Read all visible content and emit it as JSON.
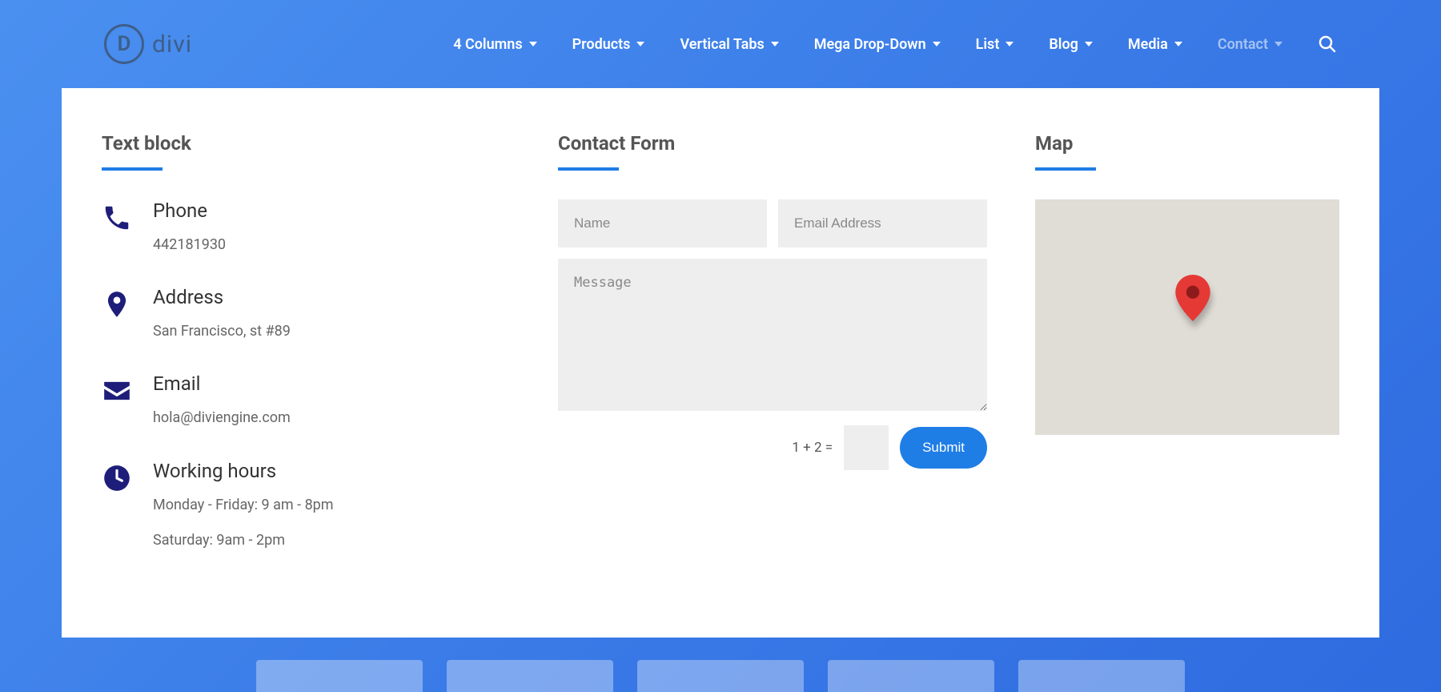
{
  "logo_text": "divi",
  "nav": [
    {
      "label": "4 Columns",
      "active": false
    },
    {
      "label": "Products",
      "active": false
    },
    {
      "label": "Vertical Tabs",
      "active": false
    },
    {
      "label": "Mega Drop-Down",
      "active": false
    },
    {
      "label": "List",
      "active": false
    },
    {
      "label": "Blog",
      "active": false
    },
    {
      "label": "Media",
      "active": false
    },
    {
      "label": "Contact",
      "active": true
    }
  ],
  "text_block": {
    "title": "Text block",
    "phone": {
      "title": "Phone",
      "value": "442181930"
    },
    "address": {
      "title": "Address",
      "value": "San Francisco, st #89"
    },
    "email": {
      "title": "Email",
      "value": "hola@diviengine.com"
    },
    "hours": {
      "title": "Working hours",
      "line1": "Monday - Friday: 9 am - 8pm",
      "line2": "Saturday: 9am - 2pm"
    }
  },
  "contact_form": {
    "title": "Contact Form",
    "name_placeholder": "Name",
    "email_placeholder": "Email Address",
    "message_placeholder": "Message",
    "captcha": "1 + 2 =",
    "submit": "Submit"
  },
  "map": {
    "title": "Map"
  }
}
